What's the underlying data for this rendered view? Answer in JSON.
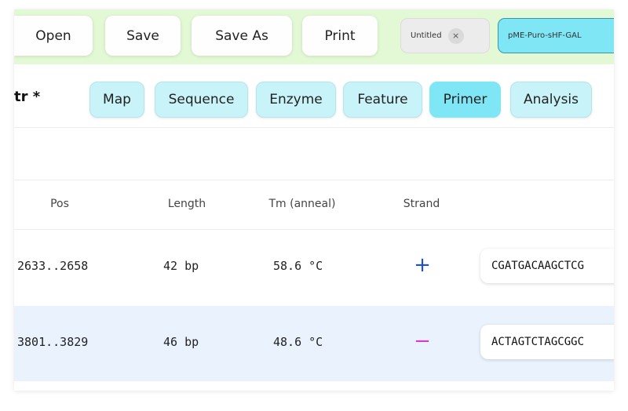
{
  "colors": {
    "toolbar_bg": "#e3f9d5",
    "nav_pill_bg": "#c8f3f9",
    "nav_pill_active_bg": "#7fe6f6",
    "doc_tab_active_bg": "#7fe6f6",
    "plus_strand": "#1f4fd8",
    "minus_strand": "#d63ad1",
    "selected_row_bg": "#eaf3fd"
  },
  "toolbar": {
    "open_label": "Open",
    "save_label": "Save",
    "save_as_label": "Save As",
    "print_label": "Print",
    "doc_tabs": [
      {
        "label": "Untitled",
        "close": "×",
        "active": false
      },
      {
        "label": "pME-Puro-sHF-GAL",
        "active": true
      }
    ]
  },
  "nav": {
    "doc_name": "tr *",
    "tabs": [
      {
        "label": "Map",
        "active": false
      },
      {
        "label": "Sequence",
        "active": false
      },
      {
        "label": "Enzyme",
        "active": false
      },
      {
        "label": "Feature",
        "active": false
      },
      {
        "label": "Primer",
        "active": true
      },
      {
        "label": "Analysis",
        "active": false
      }
    ]
  },
  "table": {
    "columns": [
      "Pos",
      "Length",
      "Tm (anneal)",
      "Strand"
    ],
    "rows": [
      {
        "pos": "2633..2658",
        "length": "42 bp",
        "tm": "58.6 °C",
        "strand": "+",
        "sequence": "CGATGACAAGCTCG"
      },
      {
        "pos": "3801..3829",
        "length": "46 bp",
        "tm": "48.6 °C",
        "strand": "−",
        "sequence": "ACTAGTCTAGCGGC"
      }
    ]
  }
}
